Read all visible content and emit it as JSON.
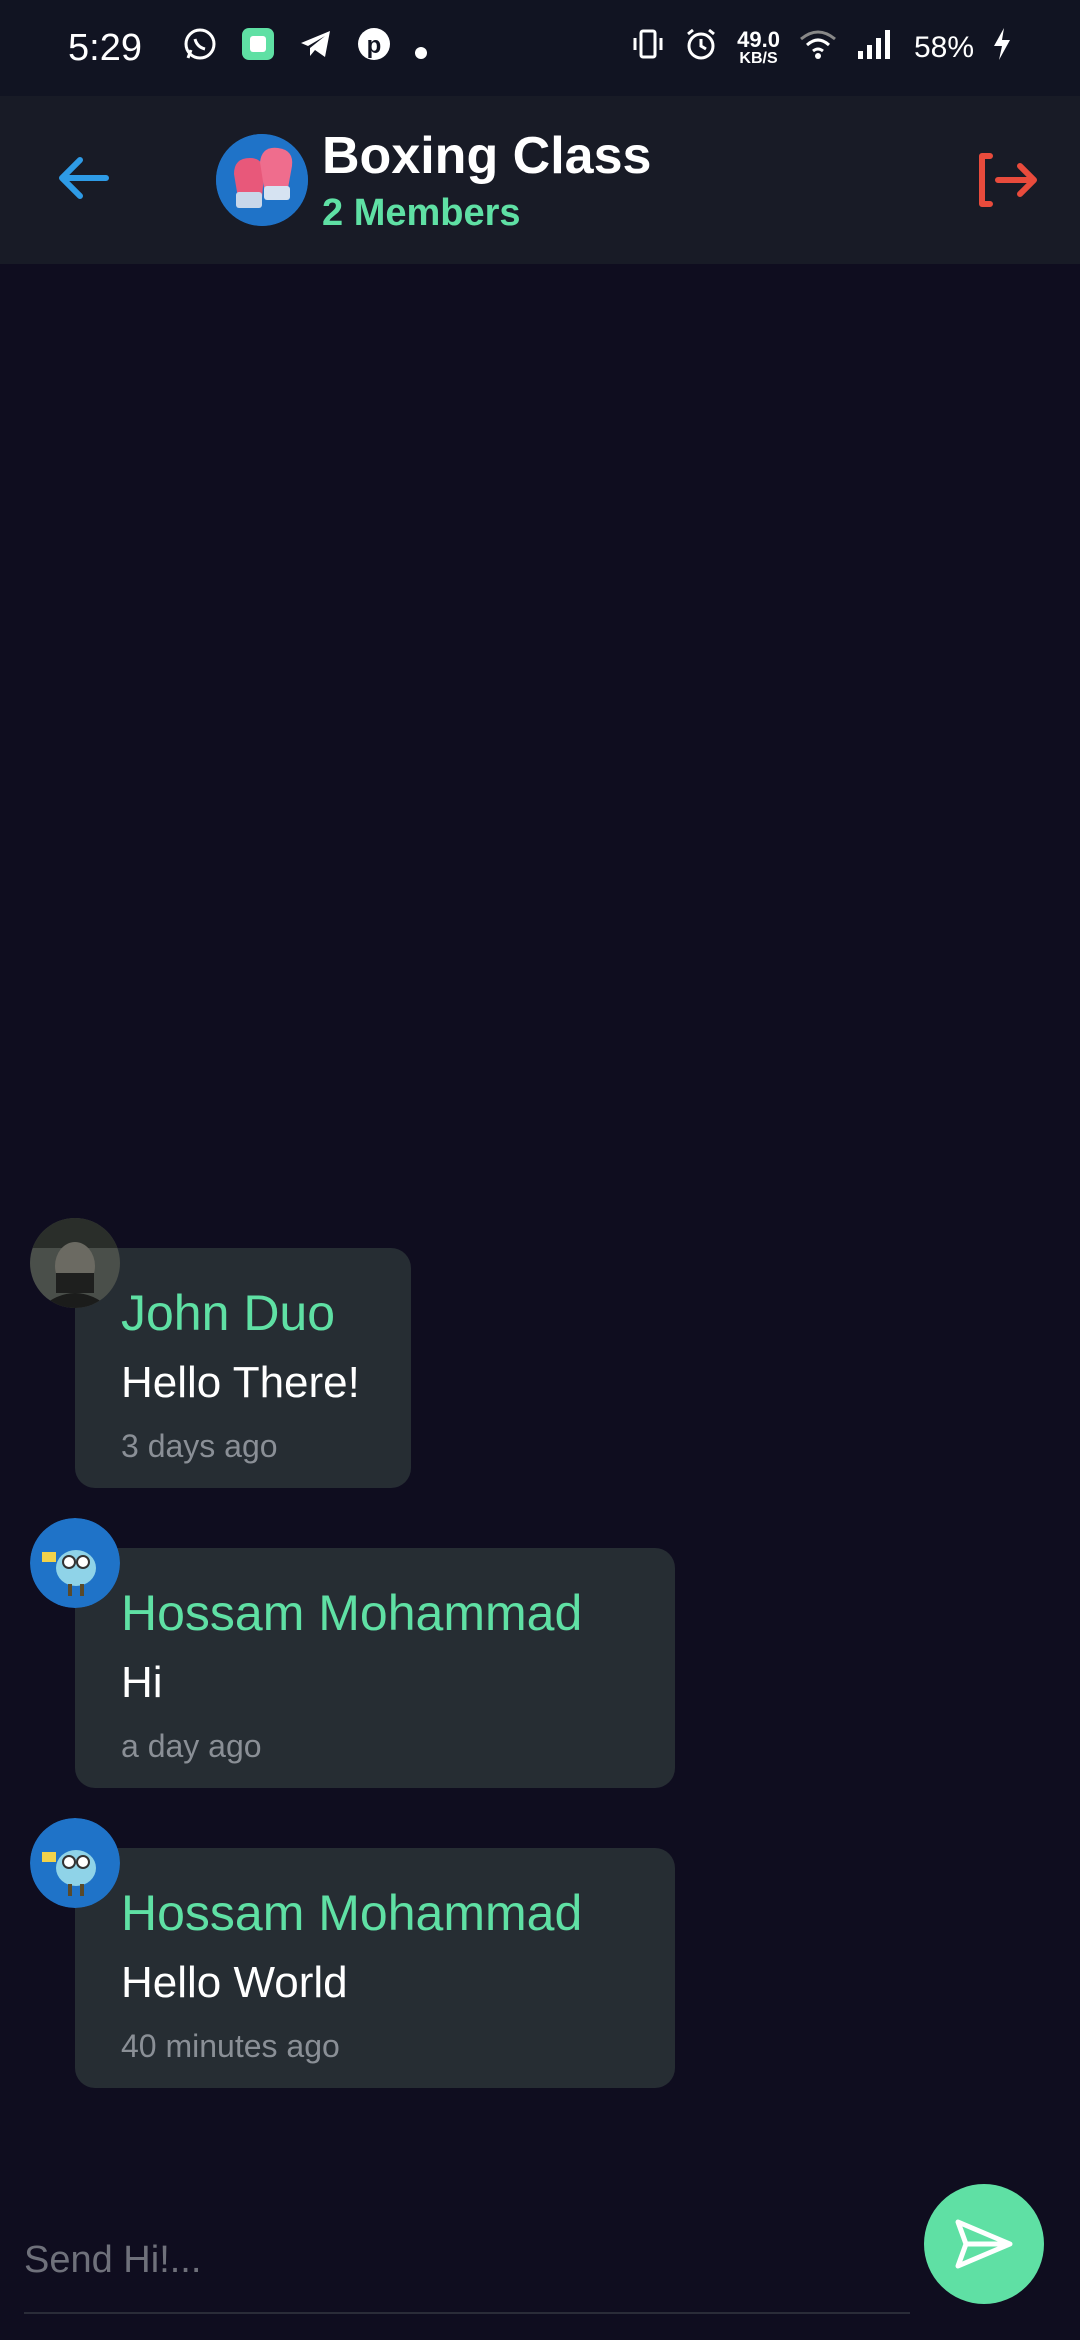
{
  "status_bar": {
    "time": "5:29",
    "net_speed_value": "49.0",
    "net_speed_unit": "KB/S",
    "battery": "58%",
    "icons": [
      "whatsapp-icon",
      "app-icon",
      "telegram-icon",
      "pinterest-icon",
      "dot-icon",
      "vibrate-icon",
      "alarm-icon",
      "wifi-icon",
      "signal-icon",
      "charging-icon"
    ]
  },
  "header": {
    "title": "Boxing Class",
    "subtitle": "2 Members",
    "accent_color": "#5fe0a4",
    "back_icon": "arrow-left-icon",
    "leave_icon": "leave-icon"
  },
  "messages": [
    {
      "sender": "John Duo",
      "text": "Hello There!",
      "time": "3 days ago"
    },
    {
      "sender": "Hossam Mohammad",
      "text": "Hi",
      "time": "a day ago"
    },
    {
      "sender": "Hossam Mohammad",
      "text": "Hello World",
      "time": "40 minutes ago"
    }
  ],
  "composer": {
    "placeholder": "Send Hi!...",
    "send_icon": "send-icon"
  }
}
